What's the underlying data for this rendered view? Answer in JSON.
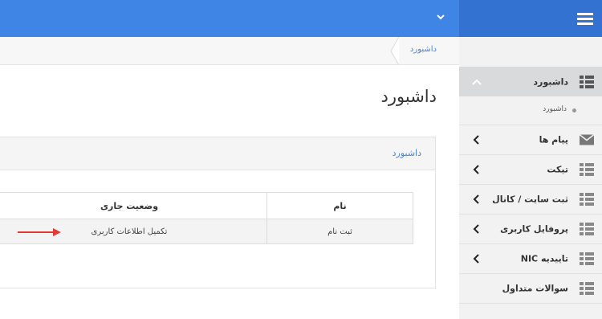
{
  "sidebar": {
    "items": [
      {
        "label": "داشبورد",
        "icon": "grid-icon",
        "expanded": true,
        "active": true
      },
      {
        "label": "پیام ها",
        "icon": "envelope-icon"
      },
      {
        "label": "تیکت",
        "icon": "grid-icon"
      },
      {
        "label": "ثبت سایت / کانال",
        "icon": "grid-icon"
      },
      {
        "label": "پروفایل کاربری",
        "icon": "grid-icon"
      },
      {
        "label": "تاییدیه NIC",
        "icon": "grid-icon"
      },
      {
        "label": "سوالات متداول",
        "icon": "grid-icon"
      }
    ],
    "subitem": {
      "label": "داشبورد"
    }
  },
  "breadcrumb": {
    "current": "داشبورد"
  },
  "page": {
    "title": "داشبورد"
  },
  "panel": {
    "title": "داشبورد",
    "table": {
      "headers": [
        "نام",
        "وضعیت جاری"
      ],
      "rows": [
        [
          "ثبت نام",
          "تکمیل اطلاعات کاربری"
        ]
      ]
    }
  },
  "colors": {
    "topbar": "#3f85e6",
    "sidebar_head": "#3372d0",
    "sidebar_bg": "#f2f2f2",
    "link": "#3f85e6",
    "annotation_arrow": "#e53935"
  }
}
